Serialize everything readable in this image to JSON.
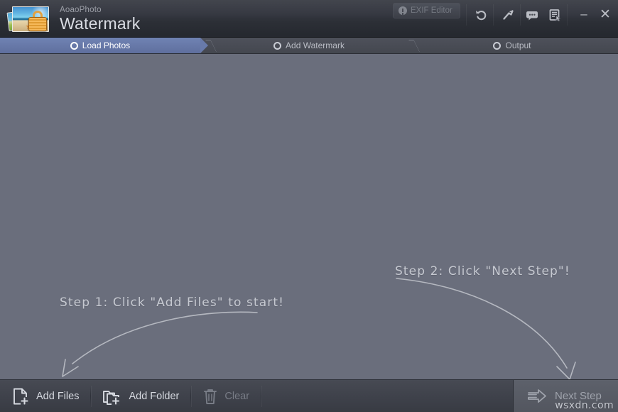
{
  "window": {
    "brand_sub": "AoaoPhoto",
    "brand_main": "Watermark",
    "logo_icon": "beach-photo-lock-icon"
  },
  "titlebar": {
    "exif_button": {
      "label": "EXIF Editor",
      "icon": "info-circle-icon",
      "disabled": true
    },
    "tools": [
      {
        "name": "undo-button",
        "icon": "undo-arrow-icon"
      },
      {
        "name": "settings-button",
        "icon": "wrench-icon"
      },
      {
        "name": "feedback-button",
        "icon": "speech-bubble-icon"
      },
      {
        "name": "register-button",
        "icon": "document-cursor-icon"
      }
    ],
    "minimize_label": "–",
    "close_label": "✕"
  },
  "steps": [
    {
      "label": "Load Photos",
      "active": true
    },
    {
      "label": "Add Watermark",
      "active": false
    },
    {
      "label": "Output",
      "active": false
    }
  ],
  "hints": {
    "step1": "Step 1: Click \"Add Files\" to start!",
    "step2": "Step 2: Click \"Next Step\"!"
  },
  "bottombar": {
    "add_files": {
      "label": "Add Files",
      "icon": "file-plus-icon",
      "disabled": false
    },
    "add_folder": {
      "label": "Add Folder",
      "icon": "folder-plus-icon",
      "disabled": false
    },
    "clear": {
      "label": "Clear",
      "icon": "trash-icon",
      "disabled": true
    },
    "next_step": {
      "label": "Next Step",
      "icon": "arrow-right-icon"
    }
  },
  "overlay": {
    "watermark": "wsxdn.com"
  },
  "colors": {
    "accent_step": "#6a7bac",
    "content_bg": "#6a6e7c",
    "titlebar_bg": "#32353d",
    "bottombar_bg": "#3f424b"
  }
}
